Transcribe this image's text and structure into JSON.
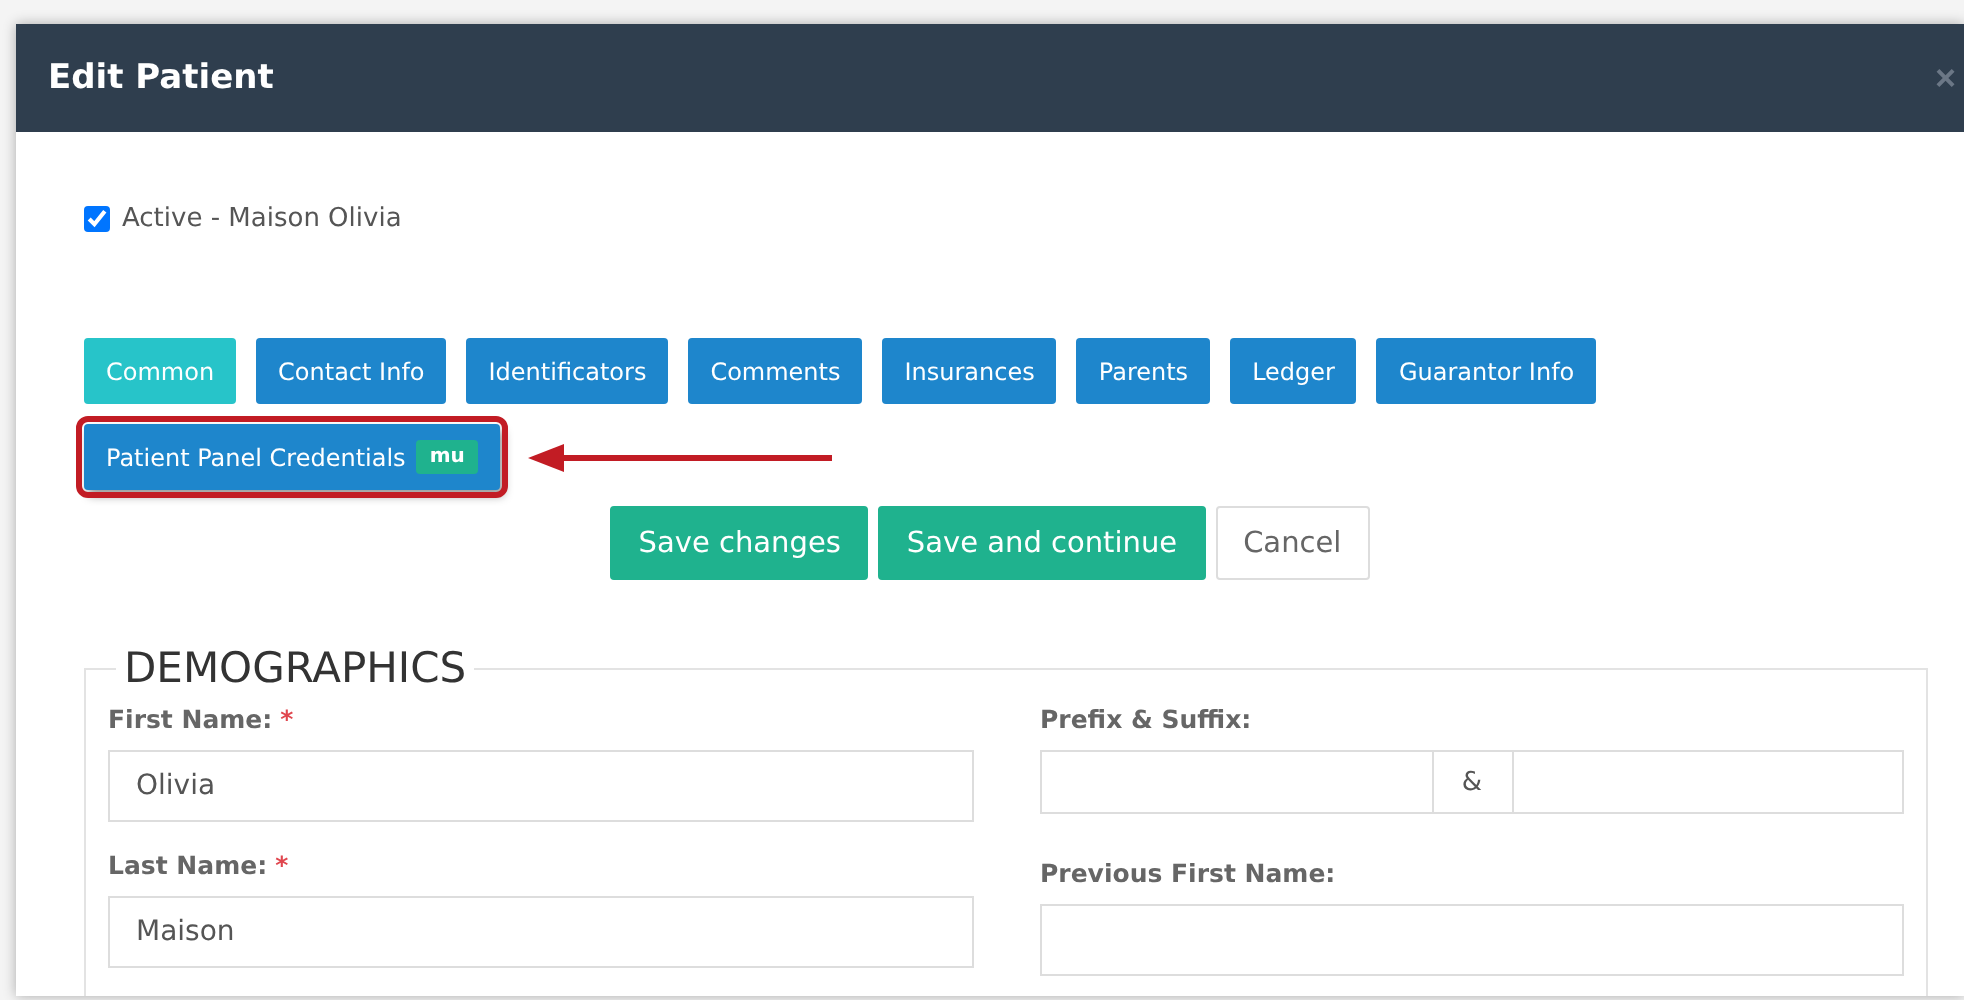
{
  "window": {
    "title": "Edit Patient",
    "close": "×"
  },
  "active": {
    "checked": true,
    "label": "Active - Maison Olivia"
  },
  "tabs": [
    {
      "label": "Common",
      "selected": true,
      "highlighted": false
    },
    {
      "label": "Contact Info",
      "selected": false,
      "highlighted": false
    },
    {
      "label": "Identificators",
      "selected": false,
      "highlighted": false
    },
    {
      "label": "Comments",
      "selected": false,
      "highlighted": false
    },
    {
      "label": "Insurances",
      "selected": false,
      "highlighted": false
    },
    {
      "label": "Parents",
      "selected": false,
      "highlighted": false
    },
    {
      "label": "Ledger",
      "selected": false,
      "highlighted": false
    },
    {
      "label": "Guarantor Info",
      "selected": false,
      "highlighted": false
    },
    {
      "label": "Patient Panel Credentials",
      "badge": "mu",
      "selected": false,
      "highlighted": true
    }
  ],
  "buttons": [
    {
      "label": "Save changes",
      "kind": "primary"
    },
    {
      "label": "Save and continue",
      "kind": "primary"
    },
    {
      "label": "Cancel",
      "kind": "default"
    }
  ],
  "section": {
    "legend": "DEMOGRAPHICS",
    "left": [
      {
        "label": "First Name:",
        "required_mark": "*",
        "value": "Olivia"
      },
      {
        "label": "Last Name:",
        "required_mark": "*",
        "value": "Maison"
      }
    ],
    "prefix_suffix": {
      "label": "Prefix & Suffix:",
      "separator": "&"
    },
    "previous_first_name": {
      "label": "Previous First Name:"
    }
  }
}
